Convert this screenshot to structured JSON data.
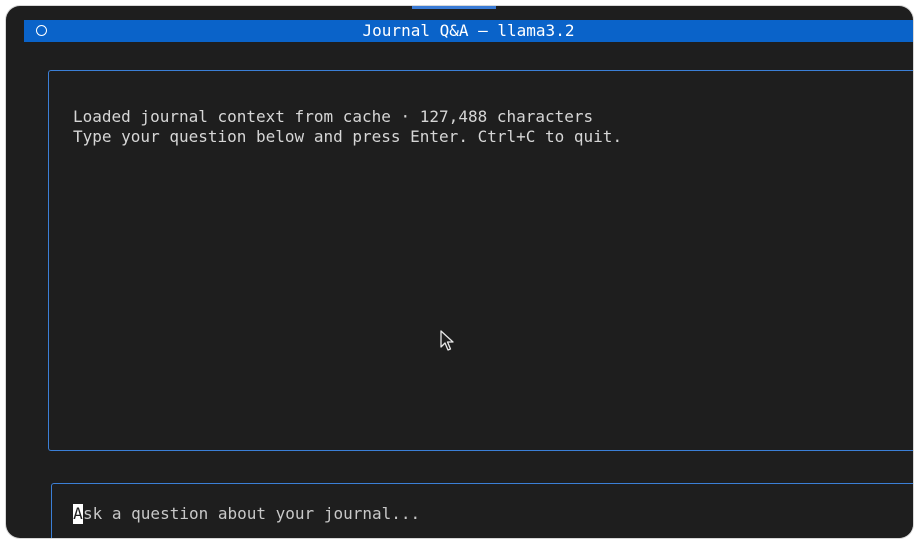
{
  "window": {
    "title": "Journal Q&A — llama3.2"
  },
  "chat": {
    "lines": [
      "Loaded journal context from cache · 127,488 characters",
      "Type your question below and press Enter. Ctrl+C to quit."
    ]
  },
  "input": {
    "caret_char": "A",
    "placeholder_rest": "sk a question about your journal..."
  },
  "colors": {
    "title_bar": "#0a63c9",
    "border_accent": "#3b7fd6",
    "background": "#1e1e1e",
    "text": "#d6d6d6"
  },
  "icons": {
    "title_indicator": "circle-icon",
    "pointer": "mouse-pointer-icon"
  }
}
